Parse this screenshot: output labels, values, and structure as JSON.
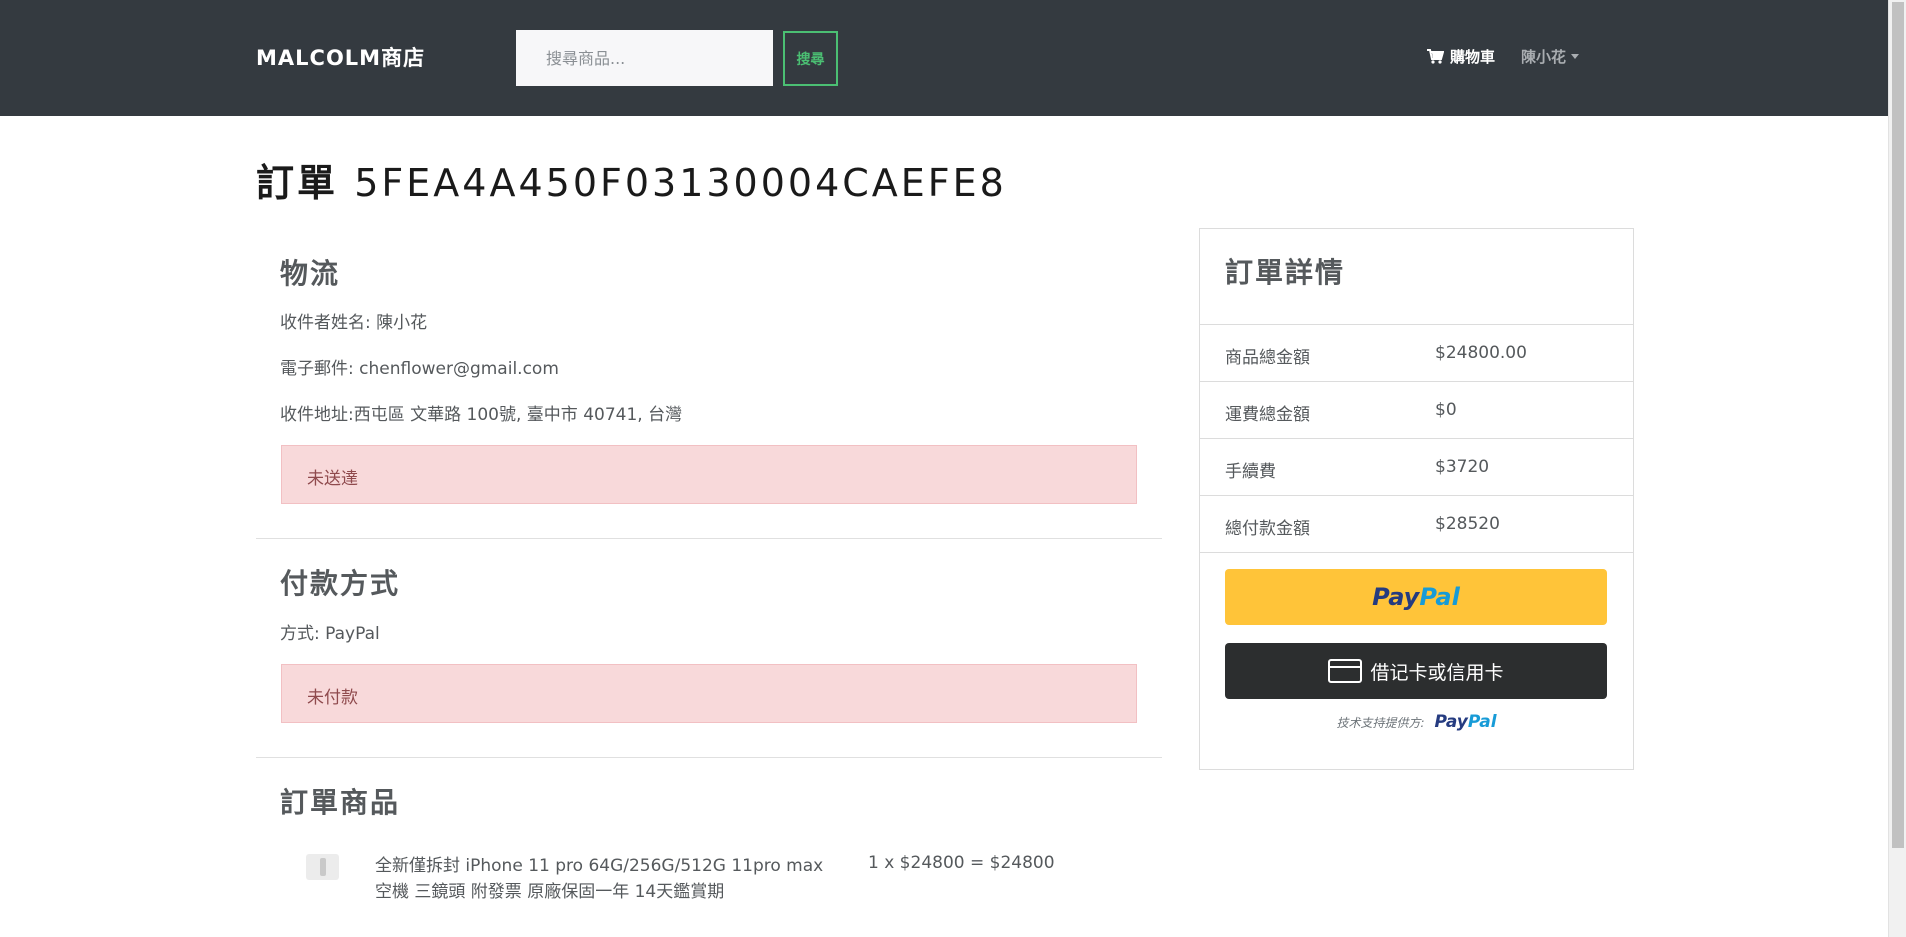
{
  "navbar": {
    "brand": "MALCOLM商店",
    "search_placeholder": "搜尋商品...",
    "search_button": "搜尋",
    "cart_label": "購物車",
    "user_name": "陳小花"
  },
  "order": {
    "title_prefix": "訂單",
    "id": "5FEA4A450F03130004CAEFE8"
  },
  "shipping": {
    "title": "物流",
    "recipient_label": "收件者姓名:",
    "recipient_name": "陳小花",
    "email_label": "電子郵件:",
    "email": "chenflower@gmail.com",
    "address_label": "收件地址:",
    "address": "西屯區 文華路 100號, 臺中市 40741, 台灣",
    "status": "未送達"
  },
  "payment": {
    "title": "付款方式",
    "method_label": "方式:",
    "method": "PayPal",
    "status": "未付款"
  },
  "items": {
    "title": "訂單商品",
    "list": [
      {
        "name": "全新僅拆封 iPhone 11 pro 64G/256G/512G 11pro max 空機 三鏡頭 附發票 原廠保固一年 14天鑑賞期",
        "price_line": "1 x $24800 = $24800"
      }
    ]
  },
  "summary": {
    "title": "訂單詳情",
    "rows": [
      {
        "label": "商品總金額",
        "amount": "$24800.00"
      },
      {
        "label": "運費總金額",
        "amount": "$0"
      },
      {
        "label": "手續費",
        "amount": "$3720"
      },
      {
        "label": "總付款金額",
        "amount": "$28520"
      }
    ],
    "paypal_pay": "Pay",
    "paypal_pal": "Pal",
    "card_button": "借记卡或信用卡",
    "powered_text": "技术支持提供方:",
    "powered_pay": "Pay",
    "powered_pal": "Pal"
  },
  "colors": {
    "navbar_bg": "#343a40",
    "accent_green": "#4bbf73",
    "alert_bg": "#f8d9da",
    "paypal_yellow": "#ffc439",
    "paypal_dark_blue": "#253b80",
    "paypal_light_blue": "#179bd7",
    "card_button_bg": "#2c2e2f"
  }
}
